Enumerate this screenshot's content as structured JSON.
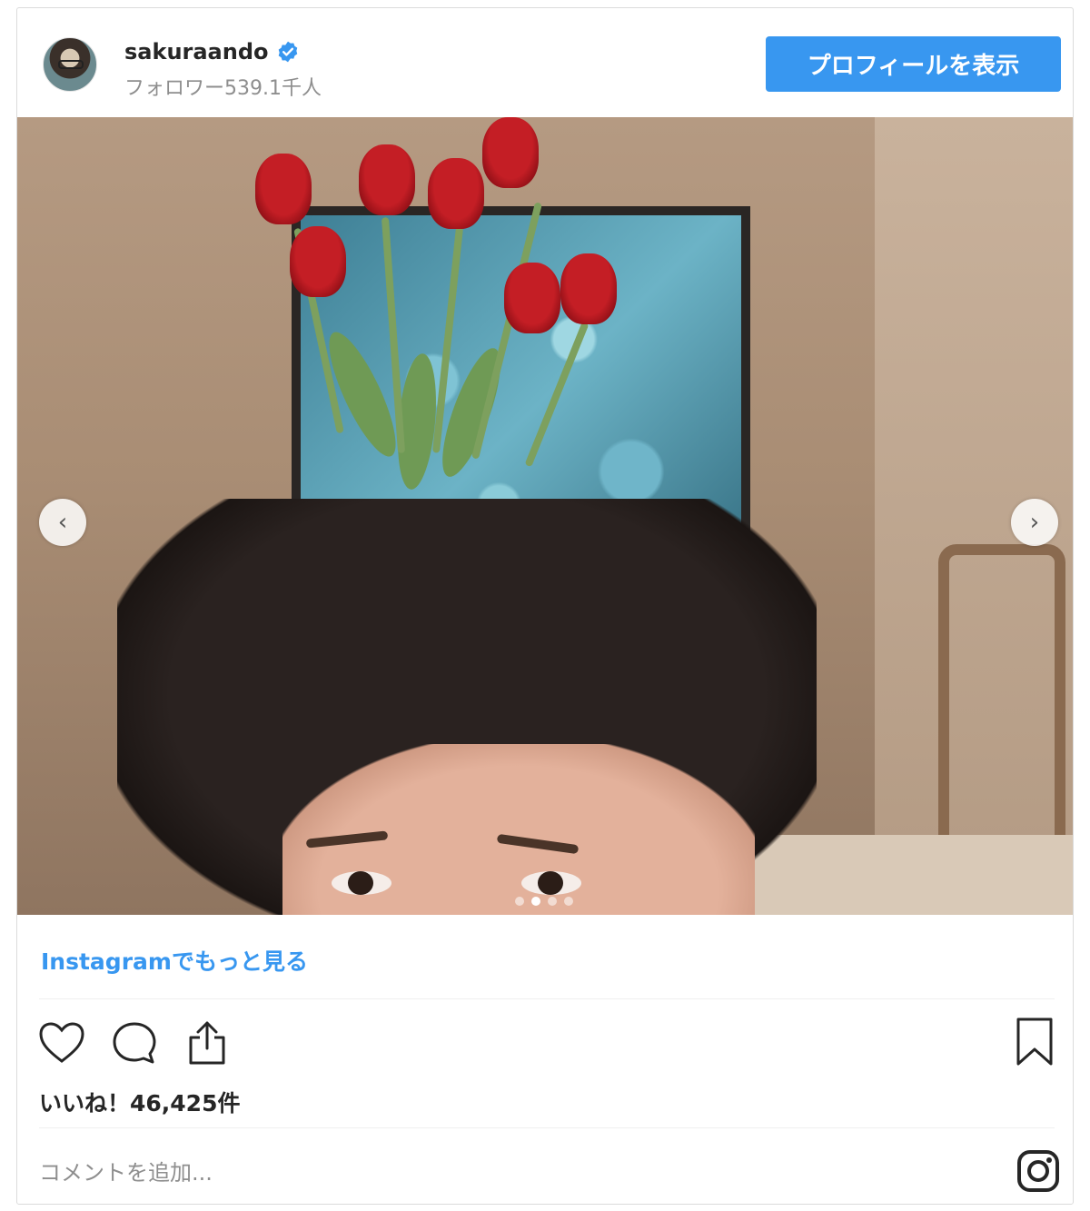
{
  "header": {
    "username": "sakuraando",
    "followers": "フォロワー539.1千人",
    "profile_button": "プロフィールを表示",
    "verified_icon": "verified-badge-icon"
  },
  "colors": {
    "accent": "#3897f0",
    "text": "#262626",
    "muted": "#8e8e8e",
    "border": "#dbdbdb"
  },
  "carousel": {
    "prev_icon": "chevron-left-icon",
    "next_icon": "chevron-right-icon",
    "prev_glyph": "‹",
    "next_glyph": "›",
    "total_slides": 4,
    "active_slide": 2
  },
  "footer": {
    "more_link": "Instagramでもっと見る",
    "likes": "いいね！46,425件",
    "comment_placeholder": "コメントを追加...",
    "icons": [
      "heart-icon",
      "comment-icon",
      "share-icon",
      "bookmark-icon",
      "instagram-icon"
    ]
  }
}
